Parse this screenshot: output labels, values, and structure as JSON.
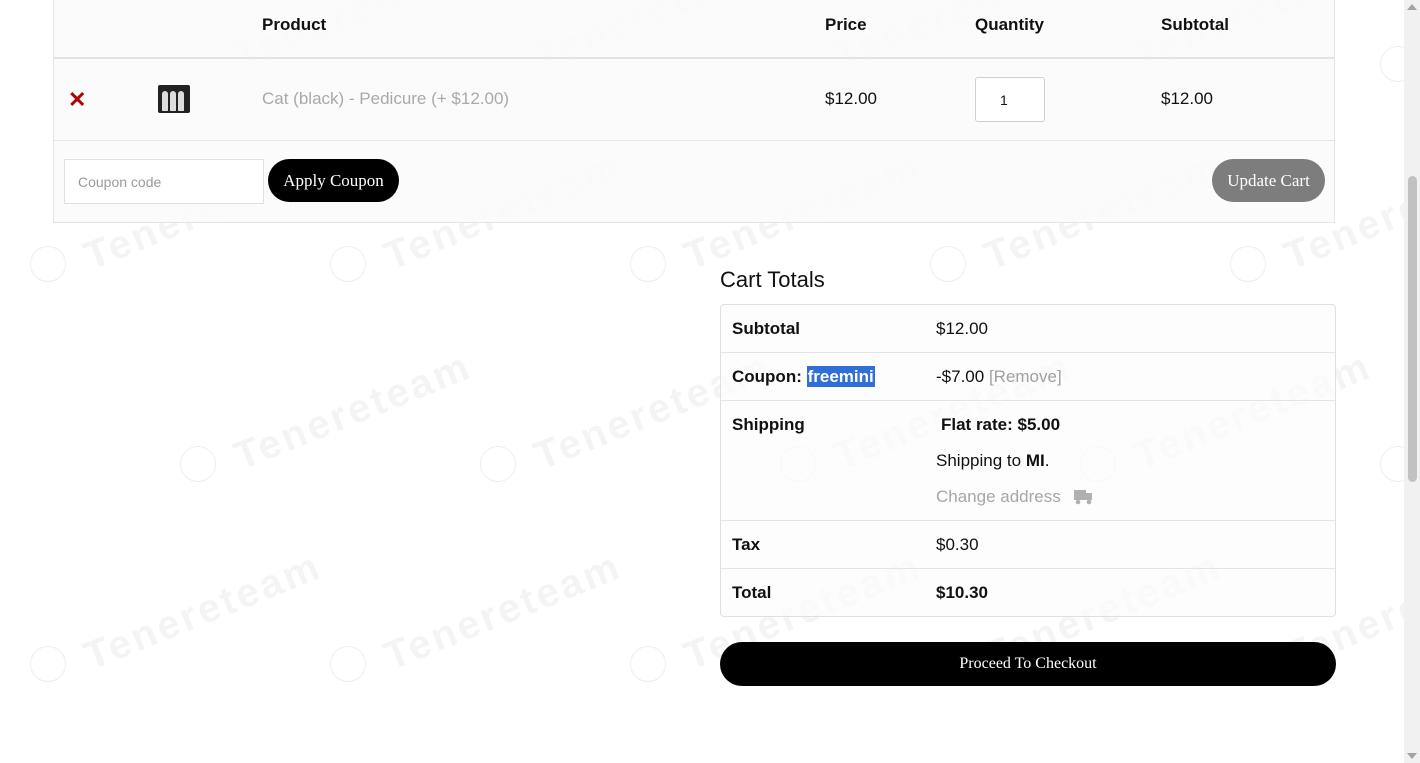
{
  "watermark": {
    "text": "Tenereteam"
  },
  "cart": {
    "headers": {
      "product": "Product",
      "price": "Price",
      "quantity": "Quantity",
      "subtotal": "Subtotal"
    },
    "items": [
      {
        "remove_icon": "close-icon",
        "name": "Cat (black) - Pedicure (+ $12.00)",
        "price": "$12.00",
        "quantity": "1",
        "subtotal": "$12.00"
      }
    ],
    "coupon_placeholder": "Coupon code",
    "apply_label": "Apply Coupon",
    "update_label": "Update Cart"
  },
  "totals": {
    "title": "Cart Totals",
    "subtotal_label": "Subtotal",
    "subtotal_value": "$12.00",
    "coupon_label": "Coupon:",
    "coupon_code": "freemini",
    "coupon_value": "-$7.00",
    "coupon_remove": "[Remove]",
    "shipping_label": "Shipping",
    "shipping_method": "Flat rate: $5.00",
    "shipping_to_prefix": "Shipping to",
    "shipping_to_region": "MI",
    "shipping_to_suffix": ".",
    "change_address": "Change address",
    "change_address_icon": "truck-icon",
    "tax_label": "Tax",
    "tax_value": "$0.30",
    "total_label": "Total",
    "total_value": "$10.30"
  },
  "checkout_label": "Proceed To Checkout",
  "colors": {
    "remove": "#b30000",
    "button_dark": "#000000",
    "button_update": "#7d7d7d",
    "coupon_highlight": "#2f6fd6",
    "muted_text": "#a9a9a9"
  }
}
